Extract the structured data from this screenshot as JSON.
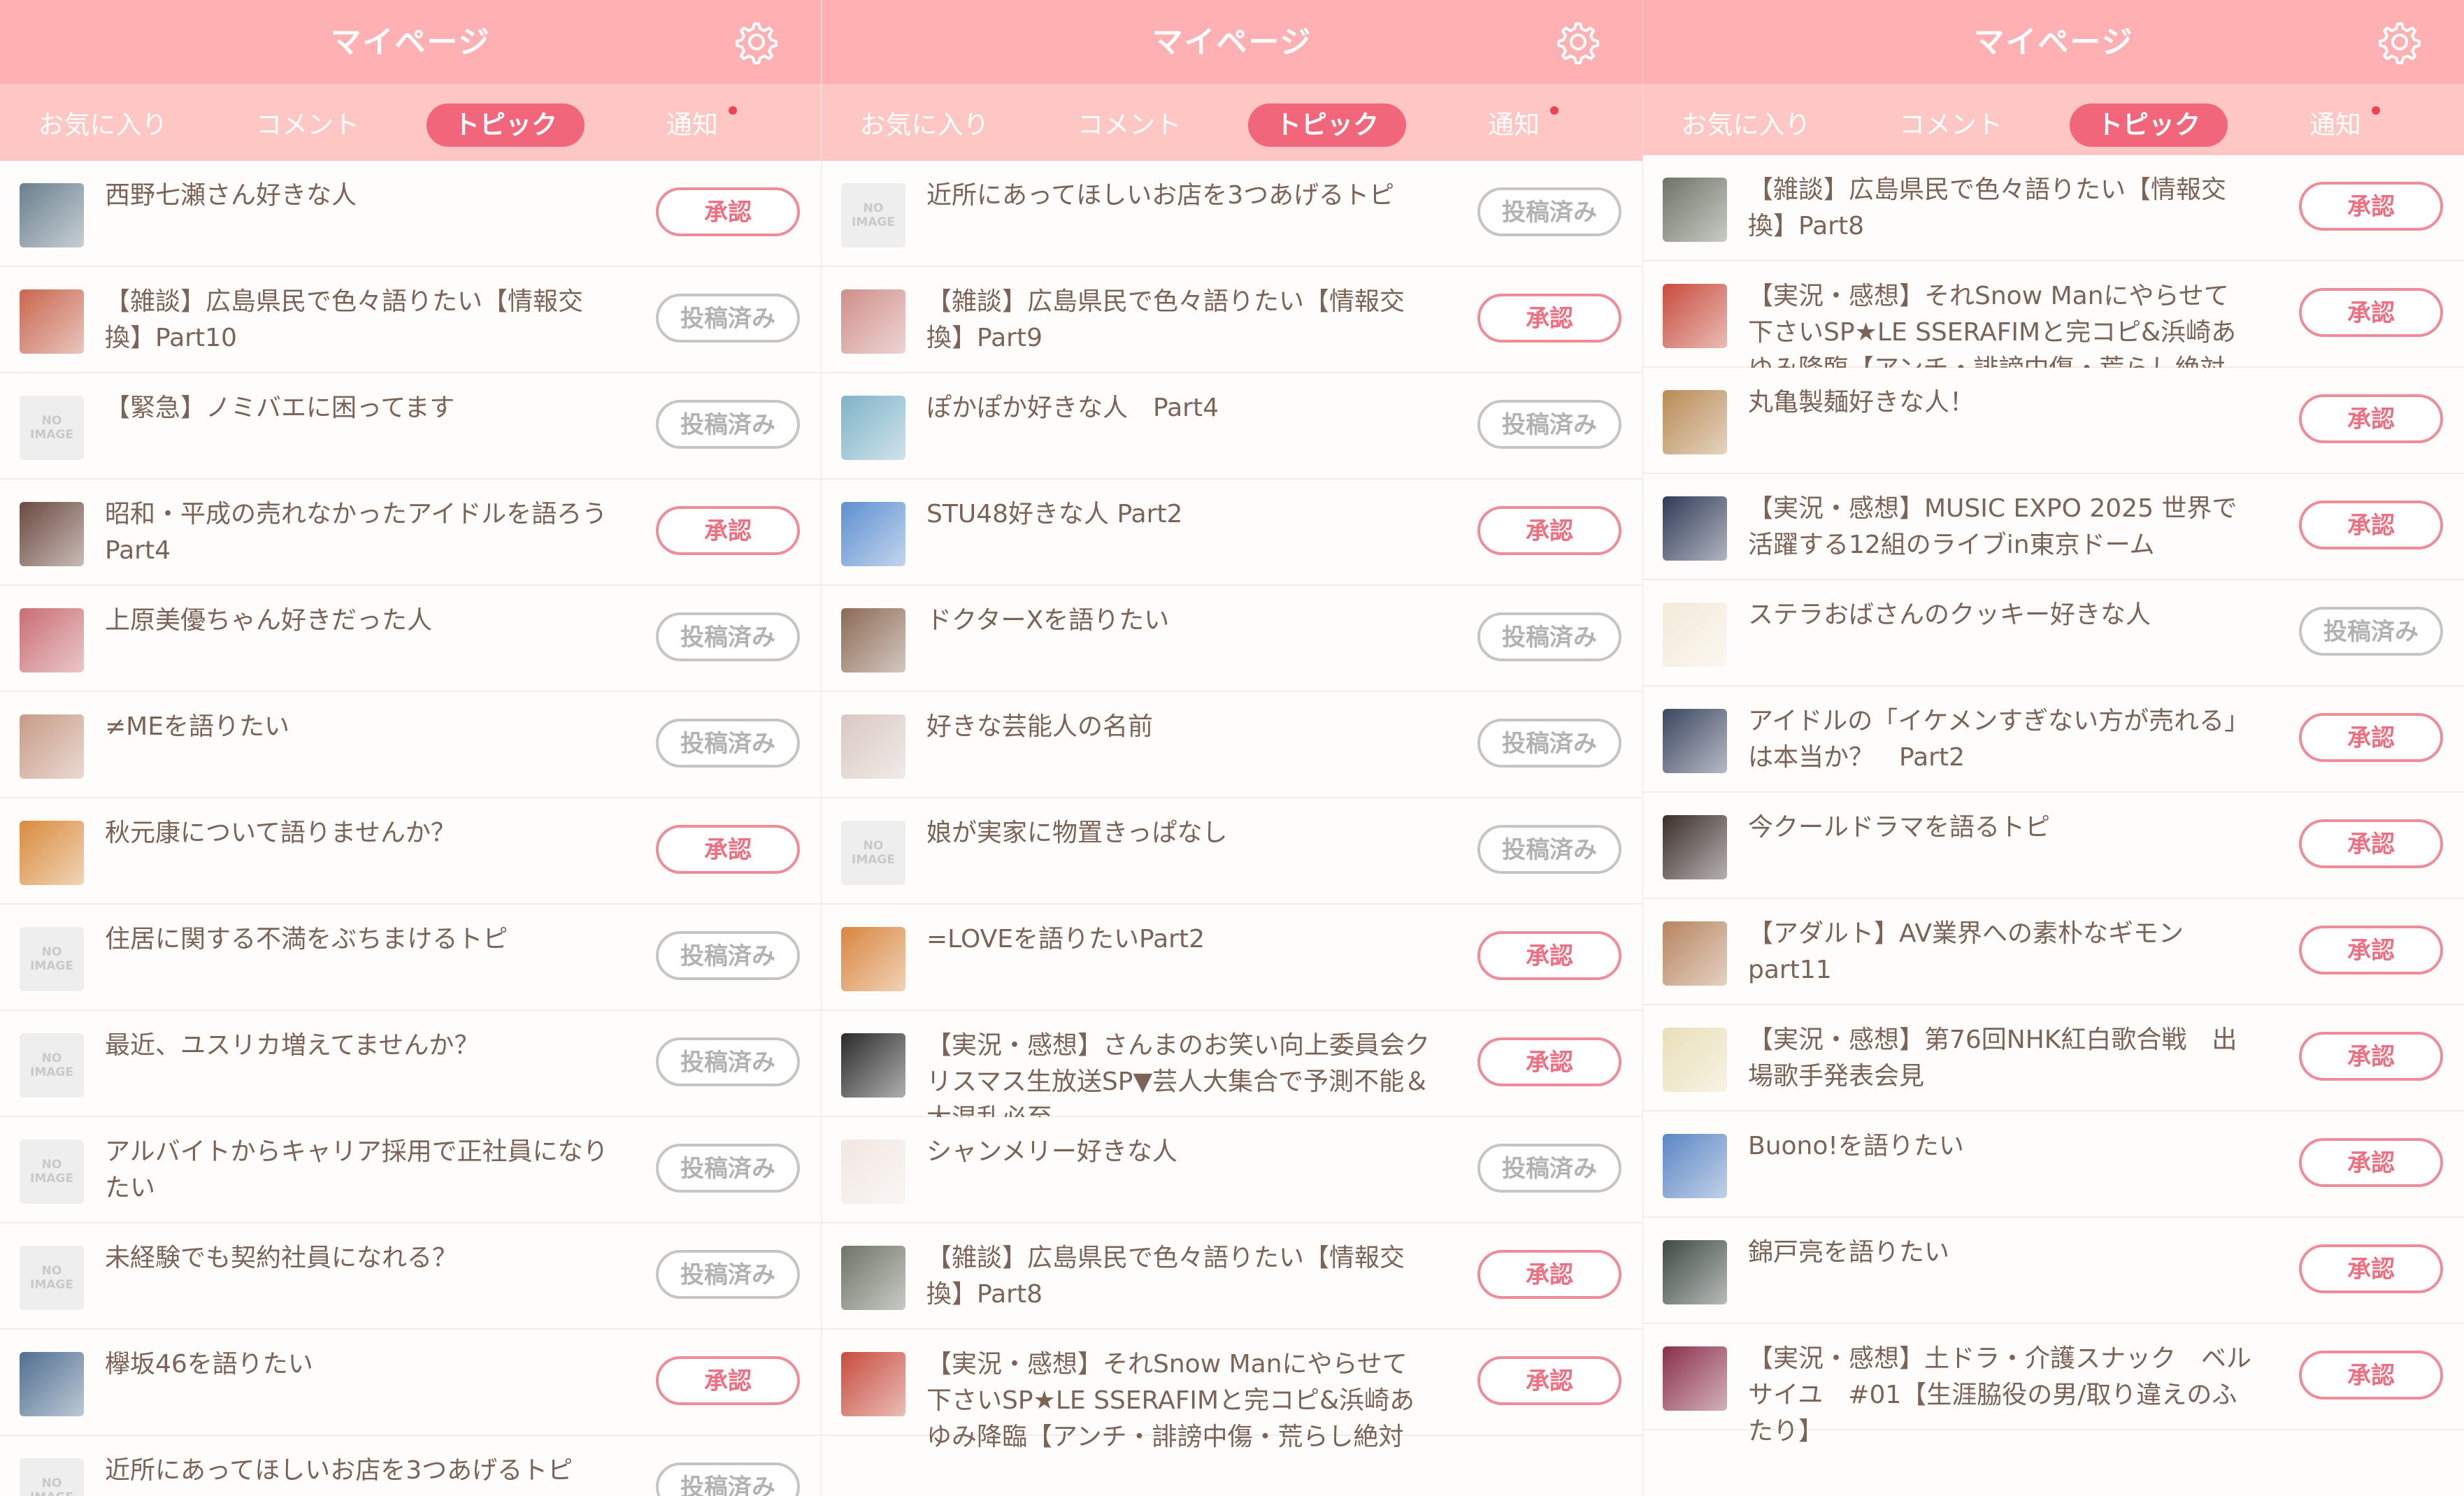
{
  "screens": [
    {
      "header_title": "マイページ",
      "tabs": [
        "お気に入り",
        "コメント",
        "トピック",
        "通知"
      ],
      "items": [
        {
          "title": "西野七瀬さん好きな人",
          "status": "承認",
          "thumb": "photo",
          "color": "#6a7f8d"
        },
        {
          "title": "【雑談】広島県民で色々語りたい【情報交換】Part10",
          "status": "投稿済み",
          "thumb": "photo",
          "color": "#c8664e"
        },
        {
          "title": "【緊急】ノミバエに困ってます",
          "status": "投稿済み",
          "thumb": "no-image"
        },
        {
          "title": "昭和・平成の売れなかったアイドルを語ろう Part4",
          "status": "承認",
          "thumb": "photo",
          "color": "#6b4a3f"
        },
        {
          "title": "上原美優ちゃん好きだった人",
          "status": "投稿済み",
          "thumb": "photo",
          "color": "#c96d73"
        },
        {
          "title": "≠MEを語りたい",
          "status": "投稿済み",
          "thumb": "photo",
          "color": "#c79b87"
        },
        {
          "title": "秋元康について語りませんか？",
          "status": "承認",
          "thumb": "photo",
          "color": "#d98b3d"
        },
        {
          "title": "住居に関する不満をぶちまけるトピ",
          "status": "投稿済み",
          "thumb": "no-image"
        },
        {
          "title": "最近、ユスリカ増えてませんか？",
          "status": "投稿済み",
          "thumb": "no-image"
        },
        {
          "title": "アルバイトからキャリア採用で正社員になりたい",
          "status": "投稿済み",
          "thumb": "no-image"
        },
        {
          "title": "未経験でも契約社員になれる？",
          "status": "投稿済み",
          "thumb": "no-image"
        },
        {
          "title": "欅坂46を語りたい",
          "status": "承認",
          "thumb": "photo",
          "color": "#4f6f8f"
        },
        {
          "title": "近所にあってほしいお店を3つあげるトピ",
          "status": "投稿済み",
          "thumb": "no-image"
        }
      ]
    },
    {
      "header_title": "マイページ",
      "tabs": [
        "お気に入り",
        "コメント",
        "トピック",
        "通知"
      ],
      "items": [
        {
          "title": "近所にあってほしいお店を3つあげるトピ",
          "status": "投稿済み",
          "thumb": "no-image"
        },
        {
          "title": "【雑談】広島県民で色々語りたい【情報交換】Part9",
          "status": "承認",
          "thumb": "photo",
          "color": "#cf8f8a"
        },
        {
          "title": "ぽかぽか好きな人　Part4",
          "status": "投稿済み",
          "thumb": "photo",
          "color": "#7fb3c8"
        },
        {
          "title": "STU48好きな人 Part2",
          "status": "承認",
          "thumb": "photo",
          "color": "#5d8fd0"
        },
        {
          "title": "ドクターXを語りたい",
          "status": "投稿済み",
          "thumb": "photo",
          "color": "#8b6a55"
        },
        {
          "title": "好きな芸能人の名前",
          "status": "投稿済み",
          "thumb": "photo",
          "color": "#d9c8c2"
        },
        {
          "title": "娘が実家に物置きっぱなし",
          "status": "投稿済み",
          "thumb": "no-image"
        },
        {
          "title": "=LOVEを語りたいPart2",
          "status": "承認",
          "thumb": "photo",
          "color": "#d9863f"
        },
        {
          "title": "【実況・感想】さんまのお笑い向上委員会クリスマス生放送SP▼芸人大集合で予測不能＆大混乱必至",
          "status": "承認",
          "thumb": "photo",
          "color": "#2a2a2a"
        },
        {
          "title": "シャンメリー好きな人",
          "status": "投稿済み",
          "thumb": "photo",
          "color": "#f1e7e2"
        },
        {
          "title": "【雑談】広島県民で色々語りたい【情報交換】Part8",
          "status": "承認",
          "thumb": "photo",
          "color": "#6e7466"
        },
        {
          "title": "【実況・感想】それSnow Manにやらせて下さいSP★LE SSERAFIMと完コピ&浜崎あゆみ降臨【アンチ・誹謗中傷・荒らし絶対禁…",
          "status": "承認",
          "thumb": "photo",
          "color": "#c84c3d"
        }
      ]
    },
    {
      "header_title": "マイページ",
      "tabs": [
        "お気に入り",
        "コメント",
        "トピック",
        "通知"
      ],
      "items": [
        {
          "title": "【雑談】広島県民で色々語りたい【情報交換】Part8",
          "status": "承認",
          "thumb": "photo",
          "color": "#6e7466"
        },
        {
          "title": "【実況・感想】それSnow Manにやらせて下さいSP★LE SSERAFIMと完コピ&浜崎あゆみ降臨【アンチ・誹謗中傷・荒らし絶対禁…",
          "status": "承認",
          "thumb": "photo",
          "color": "#c84c3d"
        },
        {
          "title": "丸亀製麺好きな人！",
          "status": "承認",
          "thumb": "photo",
          "color": "#b98a55"
        },
        {
          "title": "【実況・感想】MUSIC EXPO 2025 世界で活躍する12組のライブin東京ドーム",
          "status": "承認",
          "thumb": "photo",
          "color": "#2f3a55"
        },
        {
          "title": "ステラおばさんのクッキー好きな人",
          "status": "投稿済み",
          "thumb": "photo",
          "color": "#f3ead9"
        },
        {
          "title": "アイドルの「イケメンすぎない方が売れる」は本当か？　Part2",
          "status": "承認",
          "thumb": "photo",
          "color": "#3c4660"
        },
        {
          "title": "今クールドラマを語るトピ",
          "status": "承認",
          "thumb": "photo",
          "color": "#3b2e2a"
        },
        {
          "title": "【アダルト】AV業界への素朴なギモン part11",
          "status": "承認",
          "thumb": "photo",
          "color": "#b7855f"
        },
        {
          "title": "【実況・感想】第76回NHK紅白歌合戦　出場歌手発表会見",
          "status": "承認",
          "thumb": "photo",
          "color": "#e9dfb8"
        },
        {
          "title": "Buono!を語りたい",
          "status": "承認",
          "thumb": "photo",
          "color": "#5b86c4"
        },
        {
          "title": "錦戸亮を語りたい",
          "status": "承認",
          "thumb": "photo",
          "color": "#3f4a44"
        },
        {
          "title": "【実況・感想】土ドラ・介護スナック　ベルサイユ　#01【生涯脇役の男/取り違えのふたり】",
          "status": "承認",
          "thumb": "photo",
          "color": "#8a2f4a"
        }
      ]
    }
  ],
  "no_image_label": [
    "NO",
    "IMAGE"
  ],
  "colors": {
    "header": "#ffb0b3",
    "tabbar": "#ffc7c3",
    "active_tab": "#f2667b",
    "approve": "#ec6f82",
    "posted": "#b2b2b2",
    "text": "#7b6358",
    "notification_dot": "#ee4352"
  }
}
